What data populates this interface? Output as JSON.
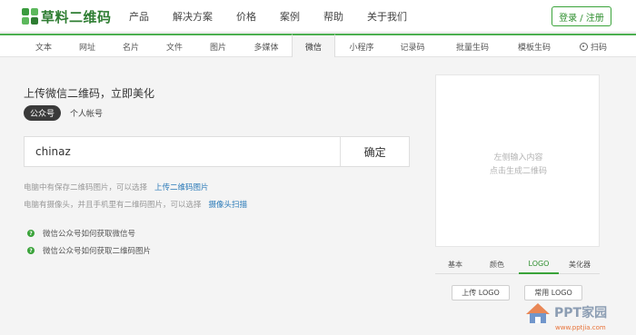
{
  "header": {
    "logo_text": "草料二维码",
    "nav": [
      "产品",
      "解决方案",
      "价格",
      "案例",
      "帮助",
      "关于我们"
    ],
    "login_label": "登录 / 注册"
  },
  "subnav": {
    "tabs": [
      "文本",
      "网址",
      "名片",
      "文件",
      "图片",
      "多媒体",
      "微信",
      "小程序",
      "记录码",
      "批量生码",
      "模板生码"
    ],
    "active": "微信",
    "scan_label": "扫码"
  },
  "main": {
    "title": "上传微信二维码，立即美化",
    "type_active": "公众号",
    "type_other": "个人帐号",
    "input_value": "chinaz",
    "confirm_label": "确定",
    "hint1_text": "电脑中有保存二维码图片，可以选择",
    "hint1_link": "上传二维码图片",
    "hint2_text": "电脑有摄像头，并且手机里有二维码图片，可以选择",
    "hint2_link": "摄像头扫描",
    "help_items": [
      "微信公众号如何获取微信号",
      "微信公众号如何获取二维码图片"
    ]
  },
  "preview": {
    "placeholder_line1": "左侧输入内容",
    "placeholder_line2": "点击生成二维码",
    "tabs": [
      "基本",
      "颜色",
      "LOGO",
      "美化器"
    ],
    "active_tab": "LOGO",
    "upload_logo_label": "上传 LOGO",
    "common_logo_label": "常用 LOGO"
  },
  "watermark": {
    "text": "PPT家园",
    "sub": "www.pptjia.com"
  },
  "colors": {
    "brand_green": "#3aa33a",
    "link_blue": "#2a7ab8"
  }
}
